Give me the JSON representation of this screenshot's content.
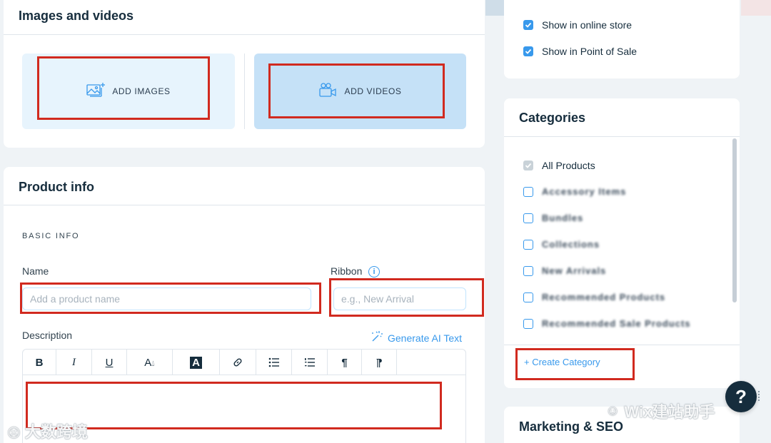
{
  "media": {
    "title": "Images and videos",
    "add_images_label": "ADD IMAGES",
    "add_videos_label": "ADD VIDEOS"
  },
  "product_info": {
    "title": "Product info",
    "section_label": "BASIC INFO",
    "name_label": "Name",
    "name_placeholder": "Add a product name",
    "ribbon_label": "Ribbon",
    "ribbon_placeholder": "e.g., New Arrival",
    "description_label": "Description",
    "generate_ai_label": "Generate AI Text",
    "toolbar": [
      "bold",
      "italic",
      "underline",
      "text-color",
      "highlight",
      "link",
      "bullet-list",
      "numbered-list",
      "ltr",
      "rtl"
    ]
  },
  "visibility": {
    "online_store_label": "Show in online store",
    "pos_label": "Show in Point of Sale"
  },
  "categories": {
    "title": "Categories",
    "all_products_label": "All Products",
    "items": [
      "Accessory Items",
      "Bundles",
      "Collections",
      "New Arrivals",
      "Recommended Products",
      "Recommended Sale Products"
    ],
    "create_label": "+ Create Category"
  },
  "marketing": {
    "title": "Marketing & SEO"
  },
  "help": {
    "label": "?"
  },
  "watermarks": {
    "left": "大数跨境",
    "right": "Wix建站助手"
  },
  "colors": {
    "accent": "#3899ec",
    "highlight_box": "#d12a1f",
    "images_tile": "#e7f4fd",
    "videos_tile": "#c5e1f7"
  }
}
